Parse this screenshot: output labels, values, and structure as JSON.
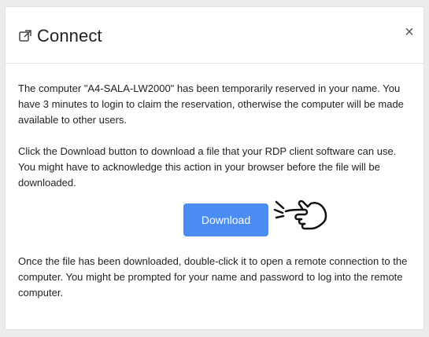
{
  "dialog": {
    "title": "Connect",
    "close_label": "×",
    "paragraph1": "The computer \"A4-SALA-LW2000\" has been temporarily reserved in your name. You have 3 minutes to login to claim the reservation, otherwise the computer will be made available to other users.",
    "paragraph2": "Click the Download button to download a file that your RDP client software can use. You might have to acknowledge this action in your browser before the file will be downloaded.",
    "download_label": "Download",
    "paragraph3": "Once the file has been downloaded, double-click it to open a remote connection to the computer. You might be prompted for your name and password to log into the remote computer."
  },
  "icons": {
    "title_icon": "external-link-icon",
    "pointer_icon": "pointing-hand-icon"
  },
  "colors": {
    "button": "#4b8cf2",
    "background": "#ececec"
  }
}
